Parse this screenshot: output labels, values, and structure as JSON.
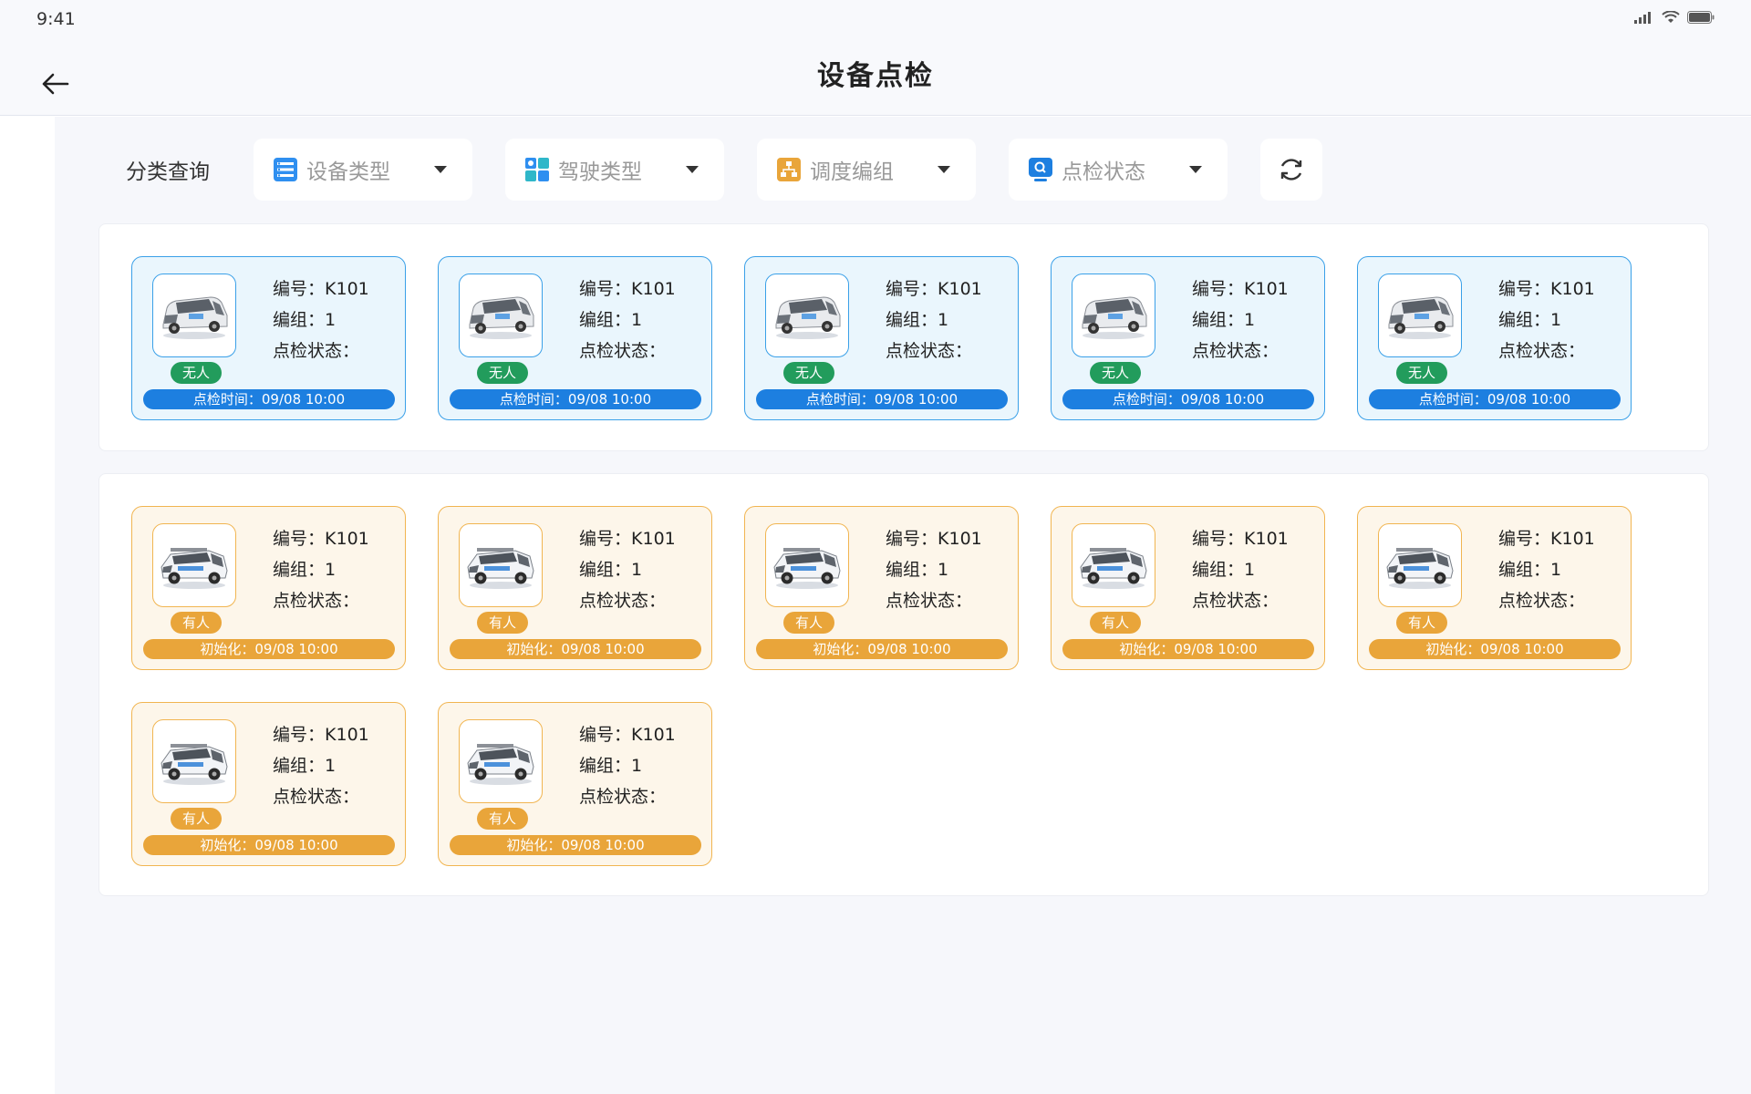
{
  "status_bar": {
    "time": "9:41",
    "icons": [
      "signal-icon",
      "wifi-icon",
      "battery-icon"
    ]
  },
  "header": {
    "title": "设备点检",
    "back_icon": "back-arrow-icon"
  },
  "filters": {
    "label": "分类查询",
    "items": [
      {
        "text": "设备类型",
        "icon": "device-list-icon",
        "color": "#2f8ff0"
      },
      {
        "text": "驾驶类型",
        "icon": "grid-icon",
        "color": "#2fb7c9"
      },
      {
        "text": "调度编组",
        "icon": "org-chart-icon",
        "color": "#e9a53a"
      },
      {
        "text": "点检状态",
        "icon": "monitor-search-icon",
        "color": "#1d7fe0"
      }
    ],
    "refresh_icon": "refresh-icon"
  },
  "labels": {
    "number": "编号：",
    "group": "编组：",
    "check_status": "点检状态："
  },
  "colors": {
    "blue_border": "#3aa0e8",
    "blue_bg": "#eaf6fd",
    "blue_bar": "#1d7fe0",
    "green_tag": "#229c5c",
    "orange_border": "#f1b551",
    "orange_bg": "#fdf6ea",
    "orange_bar": "#e9a53a"
  },
  "unmanned_cards": [
    {
      "number": "K101",
      "group": "1",
      "status": "",
      "tag": "无人",
      "bar_label": "点检时间：",
      "bar_time": "09/08 10:00",
      "vehicle_icon": "van-icon"
    },
    {
      "number": "K101",
      "group": "1",
      "status": "",
      "tag": "无人",
      "bar_label": "点检时间：",
      "bar_time": "09/08 10:00",
      "vehicle_icon": "van-icon"
    },
    {
      "number": "K101",
      "group": "1",
      "status": "",
      "tag": "无人",
      "bar_label": "点检时间：",
      "bar_time": "09/08 10:00",
      "vehicle_icon": "van-icon"
    },
    {
      "number": "K101",
      "group": "1",
      "status": "",
      "tag": "无人",
      "bar_label": "点检时间：",
      "bar_time": "09/08 10:00",
      "vehicle_icon": "van-icon"
    },
    {
      "number": "K101",
      "group": "1",
      "status": "",
      "tag": "无人",
      "bar_label": "点检时间：",
      "bar_time": "09/08 10:00",
      "vehicle_icon": "van-icon"
    }
  ],
  "manned_cards": [
    {
      "number": "K101",
      "group": "1",
      "status": "",
      "tag": "有人",
      "bar_label": "初始化：",
      "bar_time": "09/08 10:00",
      "vehicle_icon": "suv-icon"
    },
    {
      "number": "K101",
      "group": "1",
      "status": "",
      "tag": "有人",
      "bar_label": "初始化：",
      "bar_time": "09/08 10:00",
      "vehicle_icon": "suv-icon"
    },
    {
      "number": "K101",
      "group": "1",
      "status": "",
      "tag": "有人",
      "bar_label": "初始化：",
      "bar_time": "09/08 10:00",
      "vehicle_icon": "suv-icon"
    },
    {
      "number": "K101",
      "group": "1",
      "status": "",
      "tag": "有人",
      "bar_label": "初始化：",
      "bar_time": "09/08 10:00",
      "vehicle_icon": "suv-icon"
    },
    {
      "number": "K101",
      "group": "1",
      "status": "",
      "tag": "有人",
      "bar_label": "初始化：",
      "bar_time": "09/08 10:00",
      "vehicle_icon": "suv-icon"
    },
    {
      "number": "K101",
      "group": "1",
      "status": "",
      "tag": "有人",
      "bar_label": "初始化：",
      "bar_time": "09/08 10:00",
      "vehicle_icon": "suv-icon"
    },
    {
      "number": "K101",
      "group": "1",
      "status": "",
      "tag": "有人",
      "bar_label": "初始化：",
      "bar_time": "09/08 10:00",
      "vehicle_icon": "suv-icon"
    }
  ]
}
